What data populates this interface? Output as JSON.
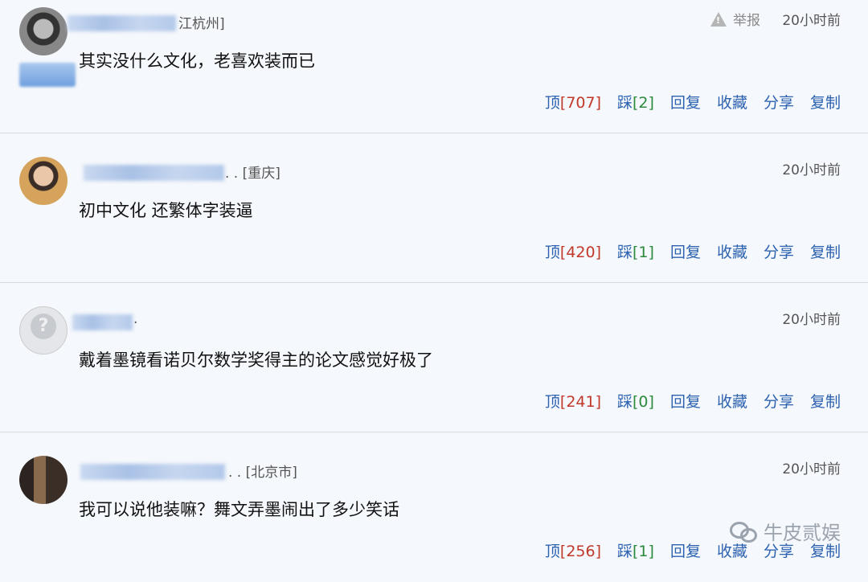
{
  "comments": [
    {
      "location": "江杭州]",
      "report": "举报",
      "time": "20小时前",
      "text": "其实没什么文化，老喜欢装而已",
      "up_label": "顶",
      "up_count": "[707]",
      "down_label": "踩",
      "down_count": "[2]",
      "reply": "回复",
      "fav": "收藏",
      "share": "分享",
      "copy": "复制"
    },
    {
      "location": ". . [重庆]",
      "time": "20小时前",
      "text": "初中文化 还繁体字装逼",
      "up_label": "顶",
      "up_count": "[420]",
      "down_label": "踩",
      "down_count": "[1]",
      "reply": "回复",
      "fav": "收藏",
      "share": "分享",
      "copy": "复制"
    },
    {
      "location": ".",
      "time": "20小时前",
      "text": "戴着墨镜看诺贝尔数学奖得主的论文感觉好极了",
      "up_label": "顶",
      "up_count": "[241]",
      "down_label": "踩",
      "down_count": "[0]",
      "reply": "回复",
      "fav": "收藏",
      "share": "分享",
      "copy": "复制"
    },
    {
      "location": ". . [北京市]",
      "time": "20小时前",
      "text": "我可以说他装嘛？舞文弄墨闹出了多少笑话",
      "up_label": "顶",
      "up_count": "[256]",
      "down_label": "踩",
      "down_count": "[1]",
      "reply": "回复",
      "fav": "收藏",
      "share": "分享",
      "copy": "复制"
    }
  ],
  "watermark": "牛皮贰娱"
}
